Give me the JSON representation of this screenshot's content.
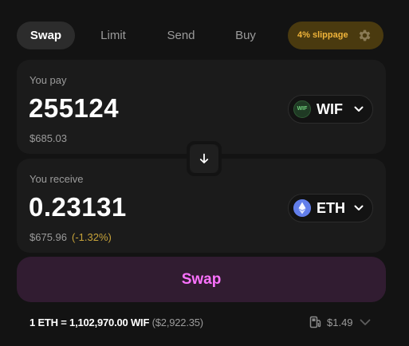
{
  "tabs": [
    {
      "label": "Swap",
      "active": true
    },
    {
      "label": "Limit",
      "active": false
    },
    {
      "label": "Send",
      "active": false
    },
    {
      "label": "Buy",
      "active": false
    }
  ],
  "slippage": {
    "label": "4% slippage",
    "icon": "gear-icon"
  },
  "pay": {
    "label": "You pay",
    "amount": "255124",
    "usd": "$685.03",
    "token": {
      "symbol": "WIF",
      "logo_text": "WIF",
      "icon": "wif-token-icon"
    }
  },
  "receive": {
    "label": "You receive",
    "amount": "0.23131",
    "usd": "$675.96",
    "price_impact": "(-1.32%)",
    "token": {
      "symbol": "ETH",
      "icon": "eth-token-icon"
    }
  },
  "switch_icon": "arrow-down-icon",
  "swap_button": {
    "label": "Swap"
  },
  "footer": {
    "rate": "1 ETH = 1,102,970.00 WIF",
    "rate_usd": "($2,922.35)",
    "gas": "$1.49",
    "gas_icon": "gas-pump-icon"
  },
  "colors": {
    "background": "#131313",
    "panel": "#1b1b1b",
    "accent_pink": "#fc72ff",
    "swap_button_bg": "#311c31",
    "slippage_text": "#f0b43a",
    "slippage_bg": "#4a3a0f",
    "eth_blue": "#627eea"
  }
}
